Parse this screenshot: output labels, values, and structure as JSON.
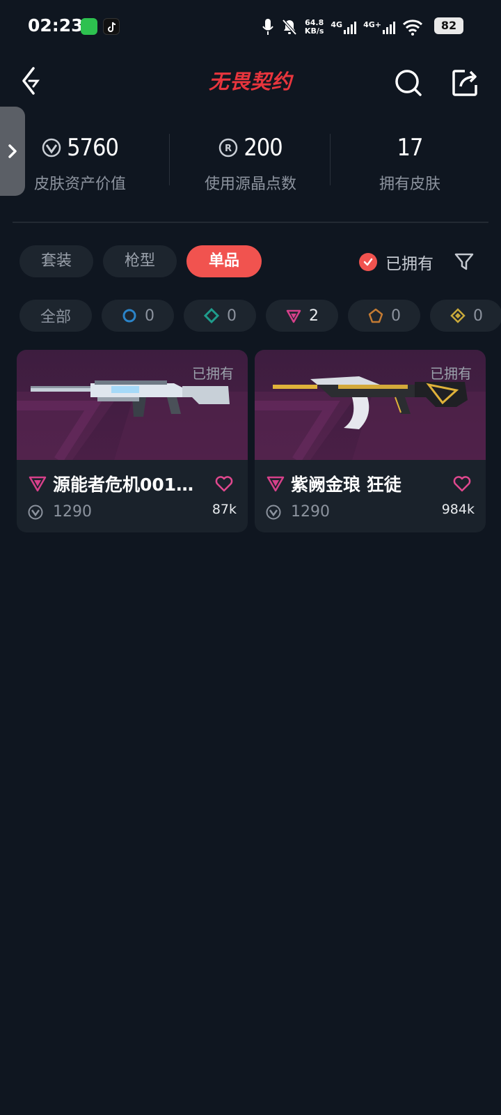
{
  "status_bar": {
    "time": "02:23",
    "net_speed": "64.8",
    "net_unit": "KB/s",
    "net1": "4G",
    "net2": "4G+",
    "battery": "82",
    "icons": [
      "wechat-icon",
      "tiktok-icon",
      "mic-icon",
      "mute-bell-icon",
      "signal-icon",
      "wifi-icon",
      "battery-icon"
    ]
  },
  "header": {
    "title": "无畏契约",
    "icons": [
      "back-icon",
      "search-icon",
      "share-icon"
    ],
    "title_color": "#e8353d"
  },
  "stats": [
    {
      "value": "5760",
      "label": "皮肤资产价值",
      "icon": "vp-coin-icon"
    },
    {
      "value": "200",
      "label": "使用源晶点数",
      "icon": "radianite-icon"
    },
    {
      "value": "17",
      "label": "拥有皮肤"
    }
  ],
  "tabs": [
    {
      "label": "套装",
      "active": false
    },
    {
      "label": "枪型",
      "active": false
    },
    {
      "label": "单品",
      "active": true
    }
  ],
  "owned_filter": {
    "label": "已拥有",
    "checked": true
  },
  "rarity_chips": [
    {
      "label": "全部"
    },
    {
      "count": "0",
      "icon": "select-tier-icon",
      "color": "#2b84c9"
    },
    {
      "count": "0",
      "icon": "deluxe-tier-icon",
      "color": "#1f9c8c"
    },
    {
      "count": "2",
      "icon": "premium-tier-icon",
      "color": "#d6408a"
    },
    {
      "count": "0",
      "icon": "exclusive-tier-icon",
      "color": "#c47b33"
    },
    {
      "count": "0",
      "icon": "ultra-tier-icon",
      "color": "#c9a93b"
    }
  ],
  "cards": [
    {
      "name": "源能者危机001…",
      "owned_tag": "已拥有",
      "price": "1290",
      "likes": "87k",
      "tier_icon": "premium-tier-icon"
    },
    {
      "name": "紫阙金琅 狂徒",
      "owned_tag": "已拥有",
      "price": "1290",
      "likes": "984k",
      "tier_icon": "premium-tier-icon"
    }
  ],
  "colors": {
    "accent": "#f1534f",
    "background": "#0f1620",
    "chip_bg": "#1d252e",
    "premium": "#d6408a"
  }
}
